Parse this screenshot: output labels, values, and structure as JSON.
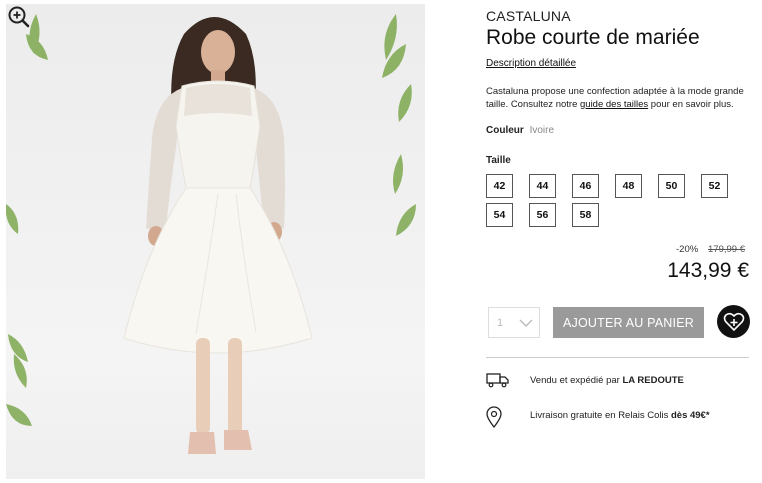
{
  "product": {
    "brand": "CASTALUNA",
    "title": "Robe courte de mariée",
    "description_link": "Description détaillée",
    "description_before": "Castaluna propose une confection adaptée à la mode grande taille. Consultez notre ",
    "description_link_text": "guide des tailles",
    "description_after": " pour en savoir plus.",
    "color_label": "Couleur",
    "color_value": "Ivoire",
    "size_label": "Taille",
    "sizes": [
      "42",
      "44",
      "46",
      "48",
      "50",
      "52",
      "54",
      "56",
      "58"
    ]
  },
  "pricing": {
    "discount": "-20%",
    "old_price": "179,99 €",
    "price": "143,99 €"
  },
  "purchase": {
    "quantity": "1",
    "add_to_cart_label": "AJOUTER AU PANIER"
  },
  "delivery": {
    "sold_by_prefix": "Vendu et expédié par ",
    "sold_by_name": "LA REDOUTE",
    "shipping_prefix": "Livraison gratuite en Relais Colis ",
    "shipping_threshold": "dès 49€*"
  },
  "icons": {
    "zoom": "zoom-in-icon",
    "chevron": "chevron-down-icon",
    "wishlist": "heart-plus-icon",
    "truck": "truck-icon",
    "location": "location-pin-icon"
  },
  "colors": {
    "cart_button": "#9a9a9a",
    "wishlist_button": "#111111"
  }
}
